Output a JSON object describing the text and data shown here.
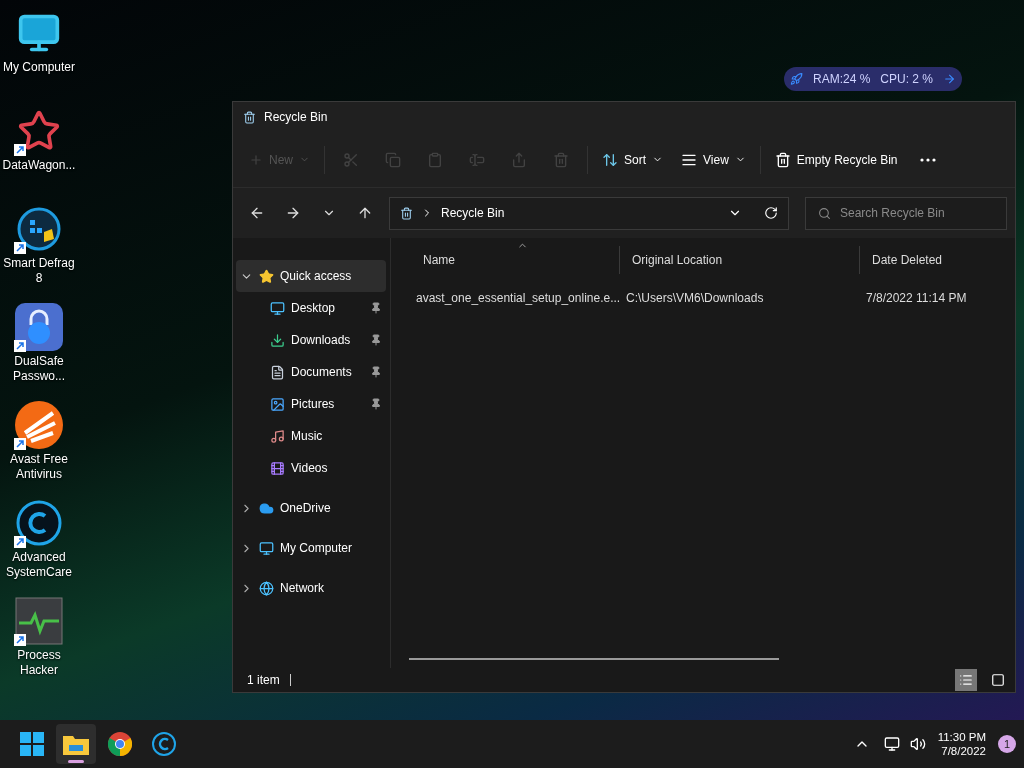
{
  "desktop": {
    "icons": [
      {
        "kind": "monitor",
        "label": "My Computer",
        "shortcut": false
      },
      {
        "kind": "star",
        "label": "DataWagon...",
        "shortcut": true
      },
      {
        "kind": "defrag",
        "label": "Smart Defrag 8",
        "shortcut": true
      },
      {
        "kind": "lock",
        "label": "DualSafe Passwo...",
        "shortcut": true
      },
      {
        "kind": "avast",
        "label": "Avast Free Antivirus",
        "shortcut": true
      },
      {
        "kind": "care",
        "label": "Advanced SystemCare",
        "shortcut": true
      },
      {
        "kind": "pulse",
        "label": "Process Hacker",
        "shortcut": true
      }
    ]
  },
  "gadget": {
    "ram": "RAM:24 %",
    "cpu": "CPU: 2 %"
  },
  "window": {
    "title": "Recycle Bin",
    "toolbar": [
      {
        "kind": "new",
        "label": "New",
        "disabled": true
      },
      {
        "kind": "cut",
        "disabled": true
      },
      {
        "kind": "copy",
        "disabled": true
      },
      {
        "kind": "paste",
        "disabled": true
      },
      {
        "kind": "rename",
        "disabled": true
      },
      {
        "kind": "share",
        "disabled": true
      },
      {
        "kind": "delete",
        "disabled": true
      },
      {
        "kind": "sort",
        "label": "Sort",
        "disabled": false
      },
      {
        "kind": "view",
        "label": "View",
        "disabled": false
      },
      {
        "kind": "empty",
        "label": "Empty Recycle Bin",
        "disabled": false
      },
      {
        "kind": "more",
        "disabled": false
      }
    ],
    "address": "Recycle Bin",
    "search": {
      "placeholder": "Search Recycle Bin"
    },
    "sidebar": {
      "items": [
        {
          "kind": "star",
          "label": "Quick access",
          "expanded": true,
          "selected": true,
          "children": [
            {
              "kind": "desktop",
              "label": "Desktop",
              "pinned": true,
              "selected": false
            },
            {
              "kind": "download",
              "label": "Downloads",
              "pinned": true,
              "selected": false
            },
            {
              "kind": "document",
              "label": "Documents",
              "pinned": true,
              "selected": false
            },
            {
              "kind": "picture",
              "label": "Pictures",
              "pinned": true,
              "selected": false
            },
            {
              "kind": "music",
              "label": "Music",
              "pinned": false,
              "selected": false
            },
            {
              "kind": "video",
              "label": "Videos",
              "pinned": false,
              "selected": false
            }
          ]
        },
        {
          "kind": "cloud",
          "label": "OneDrive",
          "expanded": false,
          "selected": false
        },
        {
          "kind": "monitor",
          "label": "My Computer",
          "expanded": false,
          "selected": false
        },
        {
          "kind": "network",
          "label": "Network",
          "expanded": false,
          "selected": false
        }
      ]
    },
    "table": {
      "columns": [
        {
          "label": "Name",
          "sorted": true
        },
        {
          "label": "Original Location",
          "sorted": false
        },
        {
          "label": "Date Deleted",
          "sorted": false
        }
      ],
      "rows": [
        {
          "cells": [
            "avast_one_essential_setup_online.e...",
            "C:\\Users\\VM6\\Downloads",
            "7/8/2022 11:14 PM"
          ]
        }
      ]
    },
    "status_bar": "1 item",
    "views": [
      {
        "kind": "details",
        "selected": true
      },
      {
        "kind": "tiles",
        "selected": false
      }
    ]
  },
  "taskbar": {
    "apps": [
      {
        "kind": "start",
        "active": false
      },
      {
        "kind": "explorer",
        "active": true
      },
      {
        "kind": "chrome",
        "active": false
      },
      {
        "kind": "care",
        "active": false
      }
    ],
    "time": "11:30 PM",
    "date": "7/8/2022",
    "notifications": "1"
  }
}
